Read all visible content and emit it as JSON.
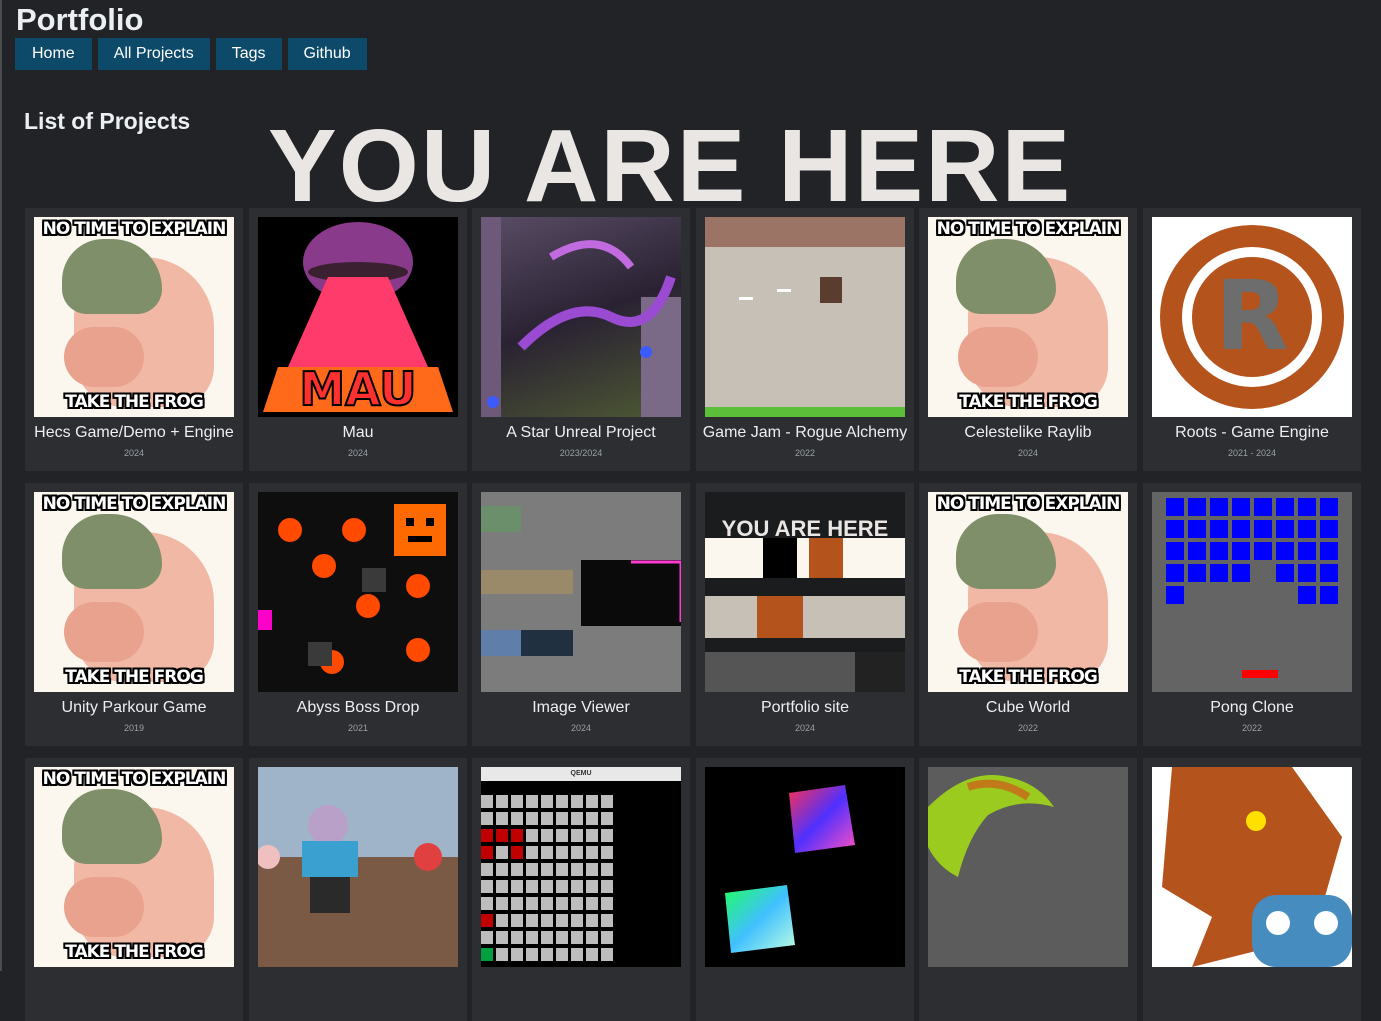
{
  "site": {
    "title": "Portfolio"
  },
  "nav": [
    {
      "label": "Home"
    },
    {
      "label": "All Projects"
    },
    {
      "label": "Tags"
    },
    {
      "label": "Github"
    }
  ],
  "page": {
    "heading": "List of Projects",
    "banner": "YOU ARE HERE"
  },
  "meme": {
    "top": "NO TIME TO EXPLAIN",
    "bottom": "TAKE THE FROG"
  },
  "projects": [
    {
      "name": "Hecs Game/Demo + Engine",
      "year": "2024",
      "thumb": "frog-meme"
    },
    {
      "name": "Mau",
      "year": "2024",
      "thumb": "mau-logo"
    },
    {
      "name": "A Star Unreal Project",
      "year": "2023/2024",
      "thumb": "unreal-scene"
    },
    {
      "name": "Game Jam - Rogue Alchemy",
      "year": "2022",
      "thumb": "pixel-game"
    },
    {
      "name": "Celestelike Raylib",
      "year": "2024",
      "thumb": "frog-meme"
    },
    {
      "name": "Roots - Game Engine",
      "year": "2021 - 2024",
      "thumb": "rust-logo"
    },
    {
      "name": "Unity Parkour Game",
      "year": "2019",
      "thumb": "frog-meme"
    },
    {
      "name": "Abyss Boss Drop",
      "year": "2021",
      "thumb": "abyss-game"
    },
    {
      "name": "Image Viewer",
      "year": "2024",
      "thumb": "image-viewer"
    },
    {
      "name": "Portfolio site",
      "year": "2024",
      "thumb": "portfolio-screenshot"
    },
    {
      "name": "Cube World",
      "year": "2022",
      "thumb": "frog-meme"
    },
    {
      "name": "Pong Clone",
      "year": "2022",
      "thumb": "breakout-game"
    },
    {
      "name": "",
      "year": "",
      "thumb": "frog-meme"
    },
    {
      "name": "",
      "year": "",
      "thumb": "3d-characters"
    },
    {
      "name": "",
      "year": "",
      "thumb": "qemu-grid"
    },
    {
      "name": "",
      "year": "",
      "thumb": "rgb-cubes"
    },
    {
      "name": "",
      "year": "",
      "thumb": "green-shape"
    },
    {
      "name": "",
      "year": "",
      "thumb": "godot-monster"
    }
  ],
  "thumb_labels": {
    "qemu": "QEMU",
    "portfolio_banner": "YOU ARE HERE"
  },
  "colors": {
    "background": "#212326",
    "nav": "#0d4a6a",
    "card": "#2c2e31"
  }
}
